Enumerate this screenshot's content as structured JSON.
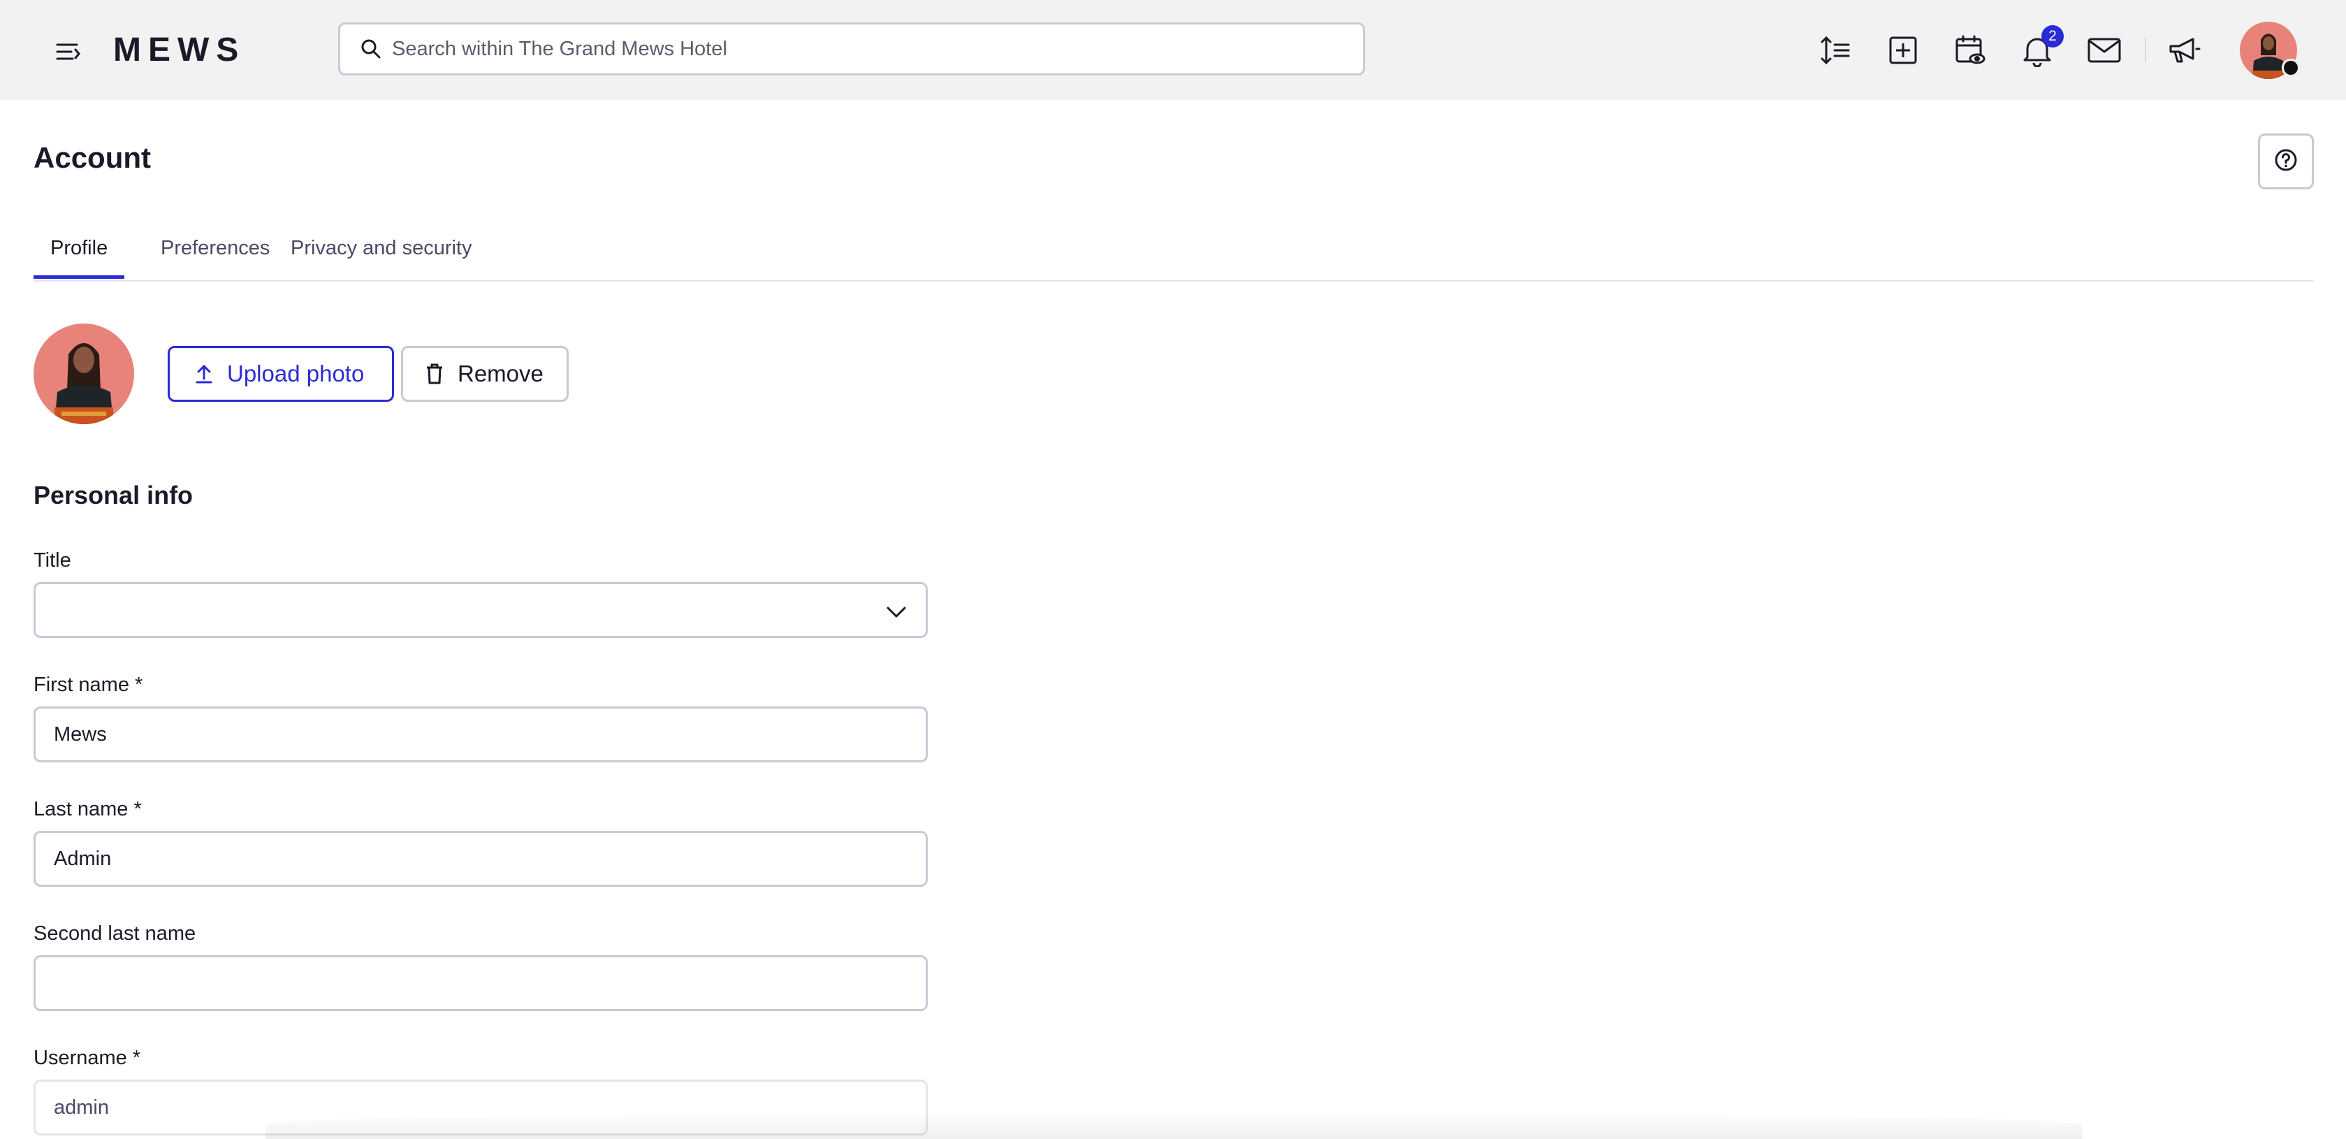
{
  "topbar": {
    "logo_text": "MEWS",
    "search_placeholder": "Search within The Grand Mews Hotel",
    "notification_count": "2",
    "icons": [
      "menu-icon",
      "sort-icon",
      "add-icon",
      "calendar-view-icon",
      "bell-icon",
      "mail-icon",
      "megaphone-icon",
      "user-avatar"
    ]
  },
  "page": {
    "title": "Account",
    "tabs": [
      {
        "label": "Profile",
        "active": true
      },
      {
        "label": "Preferences",
        "active": false
      },
      {
        "label": "Privacy and security",
        "active": false
      }
    ]
  },
  "photo": {
    "upload_label": "Upload photo",
    "remove_label": "Remove"
  },
  "personal_info": {
    "section_title": "Personal info",
    "fields": {
      "title": {
        "label": "Title",
        "value": ""
      },
      "first_name": {
        "label": "First name *",
        "value": "Mews"
      },
      "last_name": {
        "label": "Last name *",
        "value": "Admin"
      },
      "second_last_name": {
        "label": "Second last name",
        "value": ""
      },
      "username": {
        "label": "Username *",
        "value": "admin"
      }
    }
  },
  "colors": {
    "accent": "#2b2bd6",
    "topbar_bg": "#f2f2f3",
    "border": "#c9c9d6",
    "avatar_bg": "#e8837a"
  }
}
